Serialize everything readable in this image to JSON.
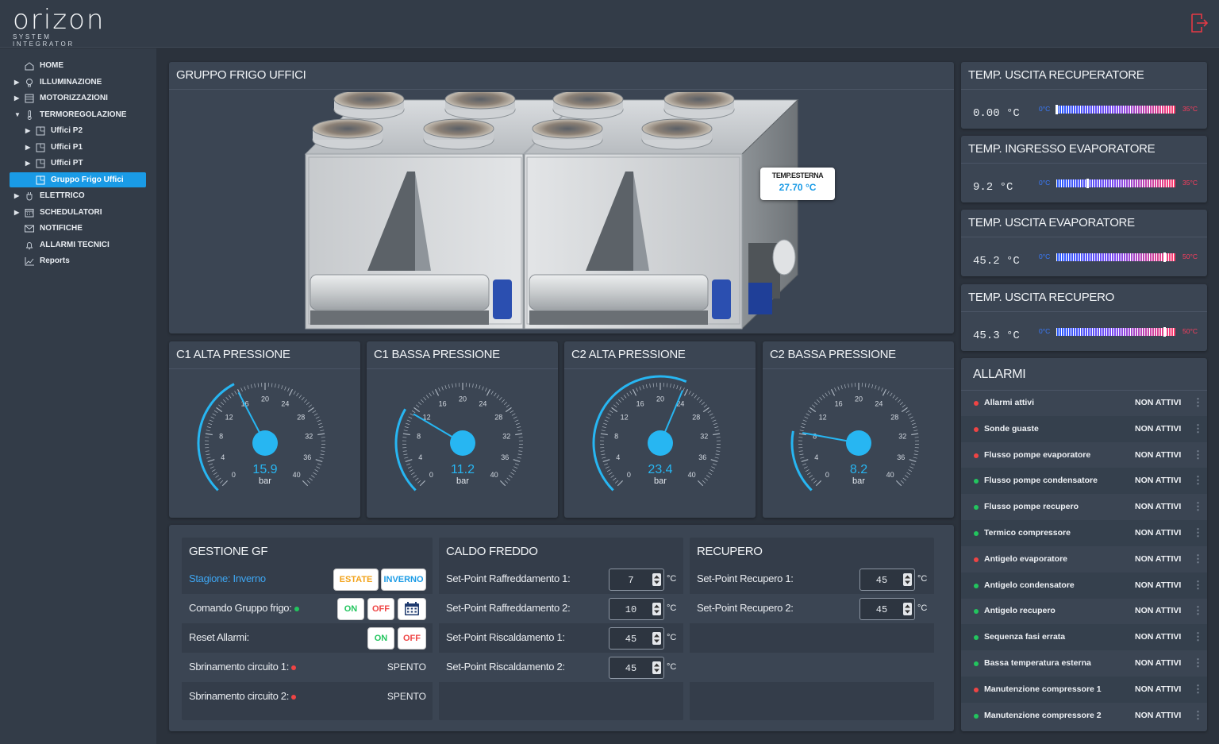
{
  "app": {
    "logo_main": "orizon",
    "logo_sub": "SYSTEM INTEGRATOR"
  },
  "colors": {
    "accent": "#1a9be6",
    "gauge": "#27b6f2",
    "ok": "#22c55e",
    "alarm": "#ef4444",
    "logout": "#e53945"
  },
  "sidebar": {
    "items": [
      {
        "label": "HOME",
        "icon": "home-icon"
      },
      {
        "label": "ILLUMINAZIONE",
        "icon": "bulb-icon"
      },
      {
        "label": "MOTORIZZAZIONI",
        "icon": "blinds-icon"
      },
      {
        "label": "TERMOREGOLAZIONE",
        "icon": "thermometer-icon"
      },
      {
        "label": "Uffici P2",
        "icon": "floorplan-icon"
      },
      {
        "label": "Uffici P1",
        "icon": "floorplan-icon"
      },
      {
        "label": "Uffici PT",
        "icon": "floorplan-icon"
      },
      {
        "label": "Gruppo Frigo Uffici",
        "icon": "floorplan-icon"
      },
      {
        "label": "ELETTRICO",
        "icon": "plug-icon"
      },
      {
        "label": "SCHEDULATORI",
        "icon": "calendar-icon"
      },
      {
        "label": "NOTIFICHE",
        "icon": "mail-icon"
      },
      {
        "label": "ALLARMI TECNICI",
        "icon": "bell-icon"
      },
      {
        "label": "Reports",
        "icon": "chart-icon"
      }
    ]
  },
  "main_panel": {
    "title": "GRUPPO FRIGO UFFICI",
    "temp_label": "TEMP.ESTERNA",
    "temp_value": "27.70 °C"
  },
  "gauges": [
    {
      "title": "C1 ALTA PRESSIONE",
      "value": 15.9,
      "value_text": "15.9",
      "unit": "bar",
      "min": 0,
      "max": 40
    },
    {
      "title": "C1 BASSA PRESSIONE",
      "value": 11.2,
      "value_text": "11.2",
      "unit": "bar",
      "min": 0,
      "max": 40
    },
    {
      "title": "C2 ALTA PRESSIONE",
      "value": 23.4,
      "value_text": "23.4",
      "unit": "bar",
      "min": 0,
      "max": 40
    },
    {
      "title": "C2 BASSA PRESSIONE",
      "value": 8.2,
      "value_text": "8.2",
      "unit": "bar",
      "min": 0,
      "max": 40
    }
  ],
  "gauge_ticks": [
    "0",
    "4",
    "8",
    "12",
    "16",
    "20",
    "24",
    "28",
    "32",
    "36",
    "40"
  ],
  "temps": [
    {
      "title": "TEMP. USCITA RECUPERATORE",
      "value": "0.00 °C",
      "v": 0.0,
      "min_label": "0°C",
      "max_label": "35°C",
      "max": 35
    },
    {
      "title": "TEMP. INGRESSO EVAPORATORE",
      "value": "9.2 °C",
      "v": 9.2,
      "min_label": "0°C",
      "max_label": "35°C",
      "max": 35
    },
    {
      "title": "TEMP. USCITA EVAPORATORE",
      "value": "45.2 °C",
      "v": 45.2,
      "min_label": "0°C",
      "max_label": "50°C",
      "max": 50
    },
    {
      "title": "TEMP. USCITA RECUPERO",
      "value": "45.3 °C",
      "v": 45.3,
      "min_label": "0°C",
      "max_label": "50°C",
      "max": 50
    }
  ],
  "alarms": {
    "title": "ALLARMI",
    "items": [
      {
        "name": "Allarmi attivi",
        "status": "NON ATTIVI",
        "dot": "red"
      },
      {
        "name": "Sonde guaste",
        "status": "NON ATTIVI",
        "dot": "red"
      },
      {
        "name": "Flusso pompe evaporatore",
        "status": "NON ATTIVI",
        "dot": "red"
      },
      {
        "name": "Flusso pompe condensatore",
        "status": "NON ATTIVI",
        "dot": "green"
      },
      {
        "name": "Flusso pompe recupero",
        "status": "NON ATTIVI",
        "dot": "green"
      },
      {
        "name": "Termico compressore",
        "status": "NON ATTIVI",
        "dot": "green"
      },
      {
        "name": "Antigelo evaporatore",
        "status": "NON ATTIVI",
        "dot": "red"
      },
      {
        "name": "Antigelo condensatore",
        "status": "NON ATTIVI",
        "dot": "green"
      },
      {
        "name": "Antigelo recupero",
        "status": "NON ATTIVI",
        "dot": "green"
      },
      {
        "name": "Sequenza fasi errata",
        "status": "NON ATTIVI",
        "dot": "green"
      },
      {
        "name": "Bassa temperatura esterna",
        "status": "NON ATTIVI",
        "dot": "green"
      },
      {
        "name": "Manutenzione compressore 1",
        "status": "NON ATTIVI",
        "dot": "red"
      },
      {
        "name": "Manutenzione compressore 2",
        "status": "NON ATTIVI",
        "dot": "green"
      }
    ]
  },
  "gestione": {
    "title": "GESTIONE GF",
    "stagione_label": "Stagione: Inverno",
    "estate_btn": "ESTATE",
    "inverno_btn": "INVERNO",
    "comando_label": "Comando Gruppo frigo:",
    "on": "ON",
    "off": "OFF",
    "reset_label": "Reset Allarmi:",
    "sbr1_label": "Sbrinamento circuito 1:",
    "sbr1_value": "SPENTO",
    "sbr2_label": "Sbrinamento circuito 2:",
    "sbr2_value": "SPENTO"
  },
  "caldo_freddo": {
    "title": "CALDO FREDDO",
    "rows": [
      {
        "label": "Set-Point Raffreddamento 1:",
        "value": "7",
        "unit": "°C"
      },
      {
        "label": "Set-Point Raffreddamento 2:",
        "value": "10",
        "unit": "°C"
      },
      {
        "label": "Set-Point Riscaldamento 1:",
        "value": "45",
        "unit": "°C"
      },
      {
        "label": "Set-Point Riscaldamento 2:",
        "value": "45",
        "unit": "°C"
      }
    ]
  },
  "recupero": {
    "title": "RECUPERO",
    "rows": [
      {
        "label": "Set-Point Recupero 1:",
        "value": "45",
        "unit": "°C"
      },
      {
        "label": "Set-Point Recupero 2:",
        "value": "45",
        "unit": "°C"
      }
    ]
  }
}
